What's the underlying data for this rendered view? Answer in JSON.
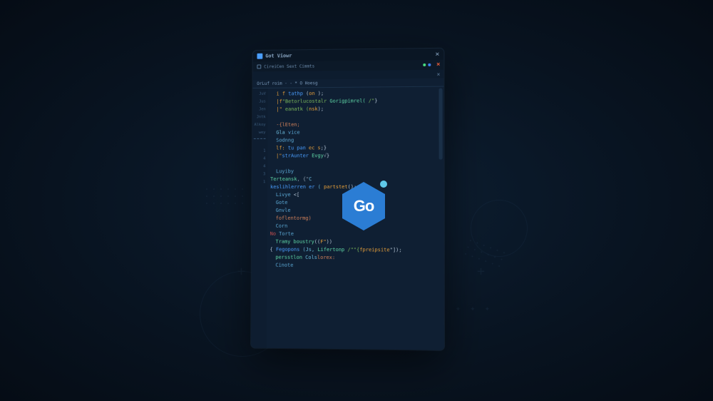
{
  "titlebar": {
    "title": "Got Viowr"
  },
  "tabbar": {
    "tab": "CireiCen Sext Cimmts"
  },
  "pathbar": {
    "text": ""
  },
  "breadcrumb": {
    "text": "OrLuf roim · - * O Hoesg"
  },
  "gutter": {
    "lines": [
      "JuV",
      "Jus",
      "Jen",
      "Jntk",
      "Alkoy",
      "wey"
    ],
    "nums": [
      "1",
      "4",
      "4",
      "3",
      "1"
    ]
  },
  "code": {
    "lines": [
      {
        "indent": 1,
        "tokens": [
          {
            "c": "tok-keyword",
            "t": "i f"
          },
          {
            "c": "tok-func",
            "t": " tathp "
          },
          {
            "c": "tok-paren",
            "t": "("
          },
          {
            "c": "tok-keyword",
            "t": "on "
          },
          {
            "c": "tok-paren",
            "t": ");"
          }
        ]
      },
      {
        "indent": 1,
        "tokens": [
          {
            "c": "tok-keyword",
            "t": "|f"
          },
          {
            "c": "tok-string",
            "t": "\"Betorlucostalr "
          },
          {
            "c": "tok-type",
            "t": "Gorigpimrel("
          },
          {
            "c": "tok-string",
            "t": " /\""
          },
          {
            "c": "tok-paren",
            "t": "}"
          }
        ]
      },
      {
        "indent": 1,
        "tokens": [
          {
            "c": "tok-keyword",
            "t": "|\""
          },
          {
            "c": "tok-string",
            "t": " eanatk ("
          },
          {
            "c": "tok-keyword",
            "t": "nsk"
          },
          {
            "c": "tok-paren",
            "t": ");"
          }
        ]
      },
      {
        "indent": 0,
        "tokens": [
          {
            "c": "tok-punc",
            "t": ""
          }
        ]
      },
      {
        "indent": 1,
        "tokens": [
          {
            "c": "tok-comment",
            "t": "-{lEten;"
          }
        ]
      },
      {
        "indent": 1,
        "tokens": [
          {
            "c": "tok-ident",
            "t": "Gla "
          },
          {
            "c": "tok-var",
            "t": "vice"
          }
        ]
      },
      {
        "indent": 1,
        "tokens": [
          {
            "c": "tok-var",
            "t": "Sodnng"
          }
        ]
      },
      {
        "indent": 1,
        "tokens": [
          {
            "c": "tok-keyword",
            "t": "lf:"
          },
          {
            "c": "tok-func",
            "t": " tu pan "
          },
          {
            "c": "tok-keyword",
            "t": "ec s"
          },
          {
            "c": "tok-paren",
            "t": ";}"
          }
        ]
      },
      {
        "indent": 1,
        "tokens": [
          {
            "c": "tok-keyword",
            "t": "|\""
          },
          {
            "c": "tok-func",
            "t": "strAunter "
          },
          {
            "c": "tok-type",
            "t": "Evgy"
          },
          {
            "c": "tok-punc",
            "t": "√"
          },
          {
            "c": "tok-paren",
            "t": "}"
          }
        ]
      },
      {
        "indent": 0,
        "tokens": []
      },
      {
        "indent": 1,
        "tokens": [
          {
            "c": "tok-var",
            "t": "Luyiby"
          }
        ]
      },
      {
        "indent": 0,
        "tokens": [
          {
            "c": "tok-type",
            "t": "Terteansk"
          },
          {
            "c": "tok-punc",
            "t": ", {\""
          },
          {
            "c": "tok-ident",
            "t": "C"
          }
        ]
      },
      {
        "indent": 0,
        "tokens": [
          {
            "c": "tok-func",
            "t": "keslihlerren er "
          },
          {
            "c": "tok-ident",
            "t": "("
          },
          {
            "c": "tok-punc",
            "t": "                   "
          },
          {
            "c": "tok-keyword",
            "t": "partstet"
          },
          {
            "c": "tok-paren",
            "t": "();"
          }
        ]
      },
      {
        "indent": 1,
        "tokens": [
          {
            "c": "tok-var",
            "t": "Livye      "
          },
          {
            "c": "tok-paren",
            "t": "<["
          }
        ]
      },
      {
        "indent": 1,
        "tokens": [
          {
            "c": "tok-var",
            "t": "Gote"
          }
        ]
      },
      {
        "indent": 1,
        "tokens": [
          {
            "c": "tok-var",
            "t": "Gnvle"
          }
        ]
      },
      {
        "indent": 1,
        "tokens": [
          {
            "c": "tok-comment",
            "t": "foflentormg)"
          }
        ]
      },
      {
        "indent": 1,
        "tokens": [
          {
            "c": "tok-var",
            "t": "Corn"
          }
        ]
      },
      {
        "indent": 0,
        "tokens": [
          {
            "c": "tok-red",
            "t": "No "
          },
          {
            "c": "tok-var",
            "t": "Torte"
          }
        ]
      },
      {
        "indent": 1,
        "tokens": [
          {
            "c": "tok-type",
            "t": "Tramy boustry"
          },
          {
            "c": "tok-paren",
            "t": "(("
          },
          {
            "c": "tok-keyword",
            "t": "F\""
          },
          {
            "c": "tok-paren",
            "t": "))"
          }
        ]
      },
      {
        "indent": 0,
        "tokens": [
          {
            "c": "tok-paren",
            "t": "{ "
          },
          {
            "c": "tok-func",
            "t": "Fegopons "
          },
          {
            "c": "tok-ident",
            "t": "(Js, "
          },
          {
            "c": "tok-type",
            "t": "Lifertonp "
          },
          {
            "c": "tok-string",
            "t": "/\"\"{"
          },
          {
            "c": "tok-keyword",
            "t": "fpreipsite"
          },
          {
            "c": "tok-paren",
            "t": "\"]);"
          }
        ]
      },
      {
        "indent": 1,
        "tokens": [
          {
            "c": "tok-type",
            "t": "persstlon "
          },
          {
            "c": "tok-ident",
            "t": "Cols"
          },
          {
            "c": "tok-comment",
            "t": "lorex:"
          }
        ]
      },
      {
        "indent": 1,
        "tokens": [
          {
            "c": "tok-var",
            "t": "Cinote"
          }
        ]
      }
    ]
  },
  "badge": {
    "text": "Go"
  }
}
